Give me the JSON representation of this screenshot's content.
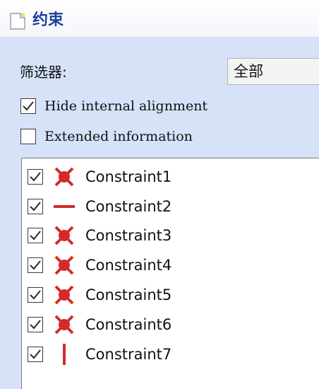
{
  "window": {
    "title": "约束",
    "title_color": "#1c3f9c",
    "title_icon": "document-icon"
  },
  "filter": {
    "label": "筛选器:",
    "selected": "全部"
  },
  "options": {
    "hide_internal_alignment": {
      "label": "Hide internal alignment",
      "checked": true
    },
    "extended_information": {
      "label": "Extended information",
      "checked": false
    }
  },
  "constraints": [
    {
      "label": "Constraint1",
      "checked": true,
      "icon": "coincident-icon"
    },
    {
      "label": "Constraint2",
      "checked": true,
      "icon": "horizontal-icon"
    },
    {
      "label": "Constraint3",
      "checked": true,
      "icon": "coincident-icon"
    },
    {
      "label": "Constraint4",
      "checked": true,
      "icon": "coincident-icon"
    },
    {
      "label": "Constraint5",
      "checked": true,
      "icon": "coincident-icon"
    },
    {
      "label": "Constraint6",
      "checked": true,
      "icon": "coincident-icon"
    },
    {
      "label": "Constraint7",
      "checked": true,
      "icon": "vertical-icon"
    }
  ],
  "colors": {
    "panel_background": "#d5e2f8",
    "constraint_icon": "#d42a2a"
  }
}
